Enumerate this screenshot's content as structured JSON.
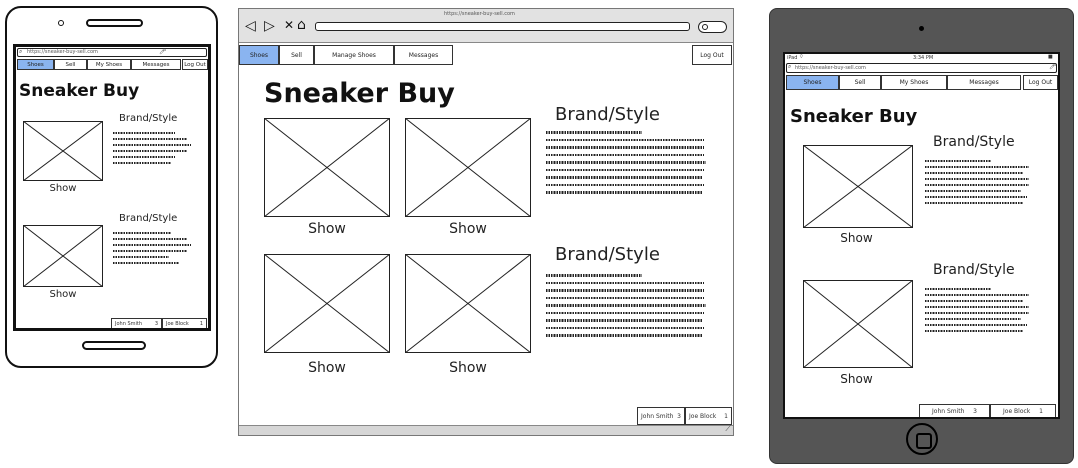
{
  "app": {
    "url": "https://sneaker-buy-sell.com",
    "site_title": "Sneaker Buy",
    "brand_style": "Brand/Style",
    "show_label": "Show"
  },
  "tabs": [
    "Shoes",
    "Sell",
    "Manage Shoes",
    "Messages"
  ],
  "tabs_small": [
    "Shoes",
    "Sell",
    "My Shoes",
    "Messages"
  ],
  "logout": "Log Out",
  "footer": [
    {
      "name": "John Smith",
      "count": "3"
    },
    {
      "name": "Joe Block",
      "count": "1"
    }
  ],
  "browser_nav": {
    "back": "◁",
    "forward": "▷",
    "stop": "✕",
    "home": "⌂"
  },
  "tablet_status": {
    "carrier": "iPad",
    "time": "3:34 PM",
    "battery": "■"
  },
  "colors": {
    "active_tab": "#8ab4f0",
    "tablet_bezel": "#555555",
    "chrome": "#e2e2e2"
  }
}
